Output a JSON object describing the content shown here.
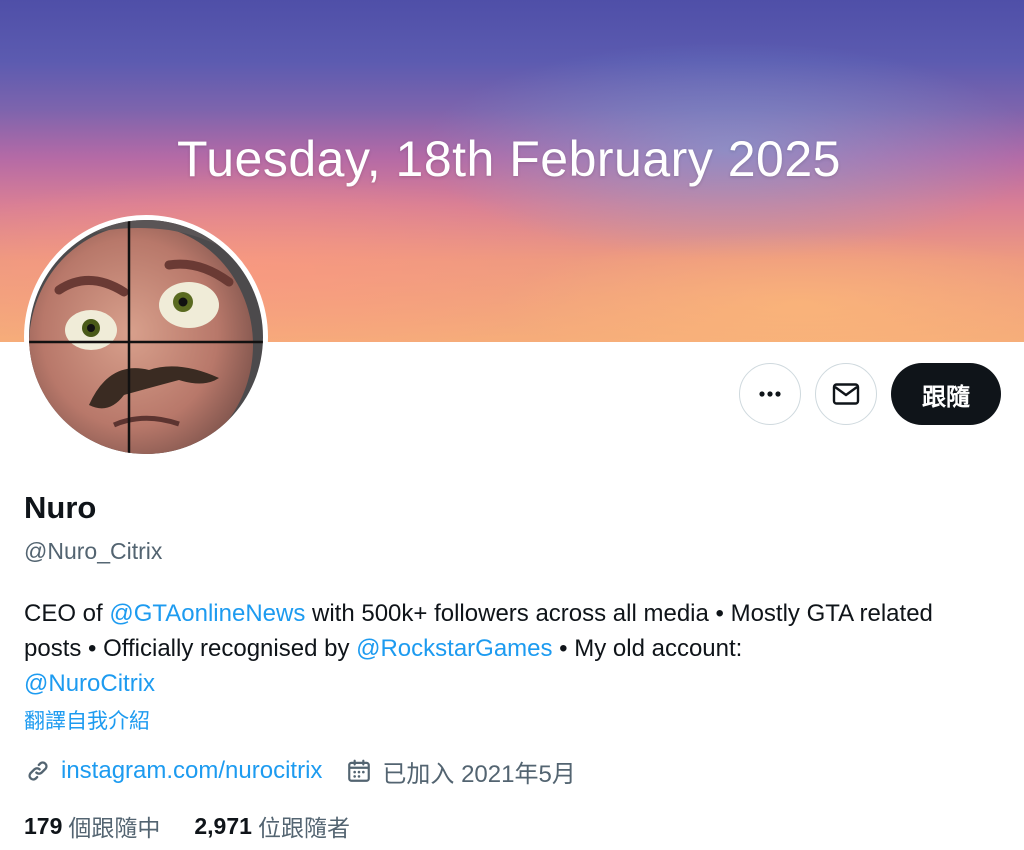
{
  "banner": {
    "date_text": "Tuesday, 18th February 2025"
  },
  "actions": {
    "follow_label": "跟隨"
  },
  "profile": {
    "name": "Nuro",
    "handle": "@Nuro_Citrix",
    "bio": {
      "t1": "CEO of ",
      "m1": "@GTAonlineNews",
      "t2": " with 500k+ followers across all media • Mostly GTA related posts • Officially recognised by ",
      "m2": "@RockstarGames",
      "t3": " • My old account: ",
      "m3": "@NuroCitrix"
    },
    "translate_label": "翻譯自我介紹",
    "website": "instagram.com/nurocitrix",
    "joined": "已加入 2021年5月"
  },
  "stats": {
    "following_count": "179",
    "following_label": "個跟隨中",
    "followers_count": "2,971",
    "followers_label": "位跟隨者"
  },
  "colors": {
    "link": "#1d9bf0",
    "text": "#0f1419",
    "secondary": "#536471",
    "button_dark": "#0f1419"
  },
  "icons": {
    "more": "more-dots-icon",
    "message": "envelope-icon",
    "link": "link-icon",
    "calendar": "calendar-icon"
  }
}
